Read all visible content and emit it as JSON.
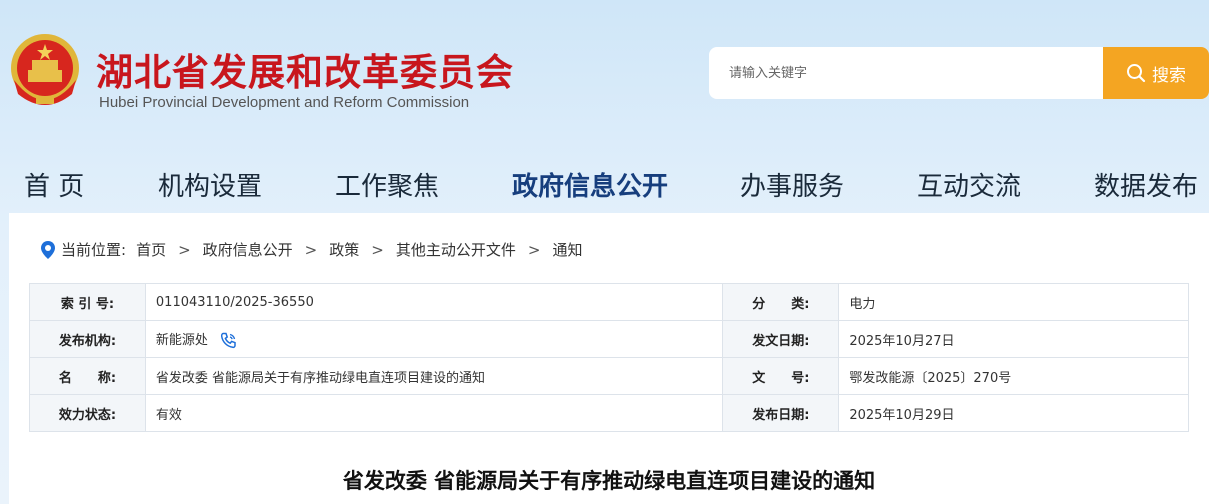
{
  "header": {
    "title_cn": "湖北省发展和改革委员会",
    "title_en": "Hubei Provincial Development and Reform Commission",
    "search_placeholder": "请输入关键字",
    "search_label": "搜索"
  },
  "nav": [
    {
      "label": "首 页"
    },
    {
      "label": "机构设置"
    },
    {
      "label": "工作聚焦"
    },
    {
      "label": "政府信息公开"
    },
    {
      "label": "办事服务"
    },
    {
      "label": "互动交流"
    },
    {
      "label": "数据发布"
    }
  ],
  "breadcrumb": {
    "prefix": "当前位置:",
    "items": [
      "首页",
      "政府信息公开",
      "政策",
      "其他主动公开文件",
      "通知"
    ],
    "sep": ">"
  },
  "meta": {
    "index_label": "索 引 号:",
    "index_value": "011043110/2025-36550",
    "category_label": "分　　类:",
    "category_value": "电力",
    "org_label": "发布机构:",
    "org_value": "新能源处",
    "doc_date_label": "发文日期:",
    "doc_date_value": "2025年10月27日",
    "name_label": "名　　称:",
    "name_value": "省发改委 省能源局关于有序推动绿电直连项目建设的通知",
    "doc_no_label": "文　　号:",
    "doc_no_value": "鄂发改能源〔2025〕270号",
    "status_label": "效力状态:",
    "status_value": "有效",
    "pub_date_label": "发布日期:",
    "pub_date_value": "2025年10月29日"
  },
  "document": {
    "title": "省发改委 省能源局关于有序推动绿电直连项目建设的通知"
  },
  "colors": {
    "brand_red": "#c8161d",
    "search_orange": "#f4a522",
    "nav_active": "#163e7d"
  }
}
